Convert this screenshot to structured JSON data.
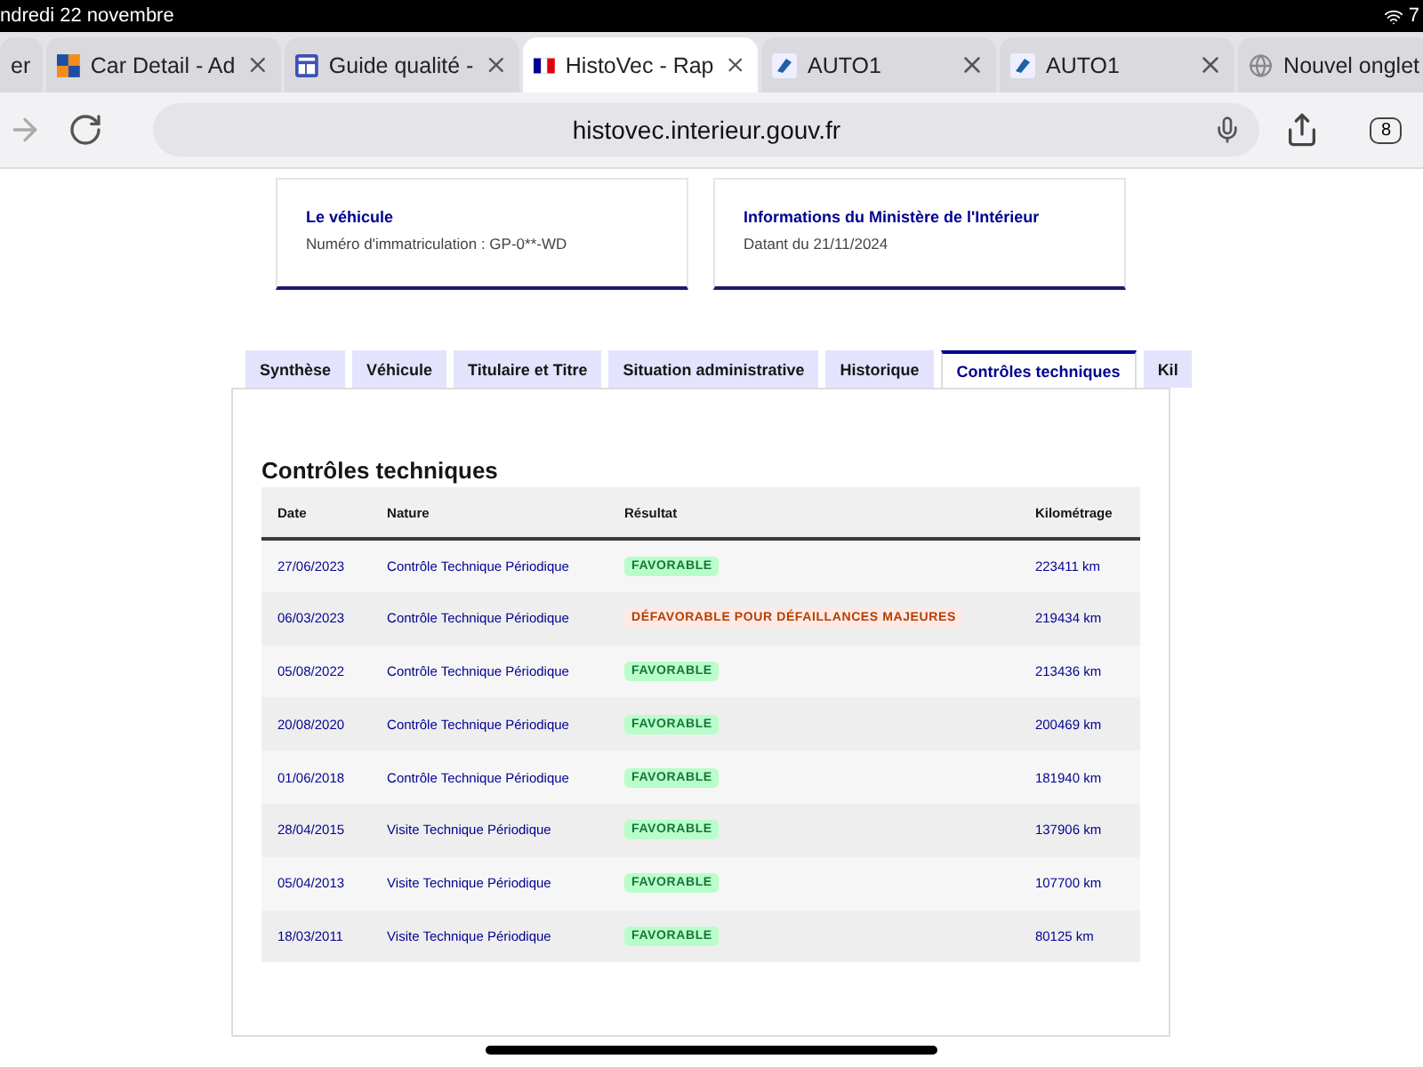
{
  "status_bar": {
    "date": "ndredi 22 novembre",
    "battery": "7"
  },
  "browser_tabs": [
    {
      "title": "er",
      "selected": false
    },
    {
      "title": "Car Detail - Ad",
      "selected": false
    },
    {
      "title": "Guide qualité -",
      "selected": false
    },
    {
      "title": "HistoVec - Rap",
      "selected": true
    },
    {
      "title": "AUTO1",
      "selected": false
    },
    {
      "title": "AUTO1",
      "selected": false
    },
    {
      "title": "Nouvel onglet",
      "selected": false
    }
  ],
  "address_bar": {
    "url": "histovec.interieur.gouv.fr",
    "tab_count": "8"
  },
  "cards": [
    {
      "title": "Le véhicule",
      "text": "Numéro d'immatriculation : GP-0**-WD"
    },
    {
      "title": "Informations du Ministère de l'Intérieur",
      "text": "Datant du 21/11/2024"
    }
  ],
  "page_tabs": [
    {
      "label": "Synthèse",
      "selected": false
    },
    {
      "label": "Véhicule",
      "selected": false
    },
    {
      "label": "Titulaire et Titre",
      "selected": false
    },
    {
      "label": "Situation administrative",
      "selected": false
    },
    {
      "label": "Historique",
      "selected": false
    },
    {
      "label": "Contrôles techniques",
      "selected": true
    },
    {
      "label": "Kil",
      "selected": false
    }
  ],
  "section_title": "Contrôles techniques",
  "table": {
    "columns": [
      "Date",
      "Nature",
      "Résultat",
      "Kilométrage"
    ],
    "rows": [
      {
        "date": "27/06/2023",
        "nature": "Contrôle Technique Périodique",
        "result": "FAVORABLE",
        "kind": "favorable",
        "km": "223411 km"
      },
      {
        "date": "06/03/2023",
        "nature": "Contrôle Technique Périodique",
        "result": "DÉFAVORABLE POUR DÉFAILLANCES MAJEURES",
        "kind": "defavorable",
        "km": "219434 km"
      },
      {
        "date": "05/08/2022",
        "nature": "Contrôle Technique Périodique",
        "result": "FAVORABLE",
        "kind": "favorable",
        "km": "213436 km"
      },
      {
        "date": "20/08/2020",
        "nature": "Contrôle Technique Périodique",
        "result": "FAVORABLE",
        "kind": "favorable",
        "km": "200469 km"
      },
      {
        "date": "01/06/2018",
        "nature": "Contrôle Technique Périodique",
        "result": "FAVORABLE",
        "kind": "favorable",
        "km": "181940 km"
      },
      {
        "date": "28/04/2015",
        "nature": "Visite Technique Périodique",
        "result": "FAVORABLE",
        "kind": "favorable",
        "km": "137906 km"
      },
      {
        "date": "05/04/2013",
        "nature": "Visite Technique Périodique",
        "result": "FAVORABLE",
        "kind": "favorable",
        "km": "107700 km"
      },
      {
        "date": "18/03/2011",
        "nature": "Visite Technique Périodique",
        "result": "FAVORABLE",
        "kind": "favorable",
        "km": "80125 km"
      }
    ]
  }
}
